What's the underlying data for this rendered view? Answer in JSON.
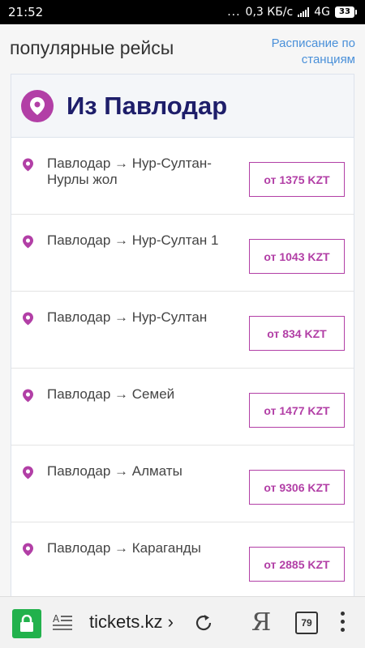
{
  "status_bar": {
    "time": "21:52",
    "dots": "...",
    "speed": "0,3 КБ/с",
    "network": "4G",
    "battery": "33"
  },
  "header": {
    "section_title": "популярные рейсы",
    "schedule_link": "Расписание по станциям"
  },
  "card": {
    "title": "Из Павлодар",
    "routes": [
      {
        "name": "Павлодар → Нур-Султан-Нурлы жол",
        "price": "от 1375 KZT"
      },
      {
        "name": "Павлодар → Нур-Султан 1",
        "price": "от 1043 KZT"
      },
      {
        "name": "Павлодар → Нур-Султан",
        "price": "от 834 KZT"
      },
      {
        "name": "Павлодар → Семей",
        "price": "от 1477 KZT"
      },
      {
        "name": "Павлодар → Алматы",
        "price": "от 9306 KZT"
      },
      {
        "name": "Павлодар → Караганды",
        "price": "от 2885 KZT"
      }
    ]
  },
  "browser_bar": {
    "url": "tickets.kz › ",
    "yandex": "Я",
    "tabs_count": "79",
    "icons": [
      "lock-icon",
      "reader-mode-icon",
      "reload-icon",
      "yandex-icon",
      "tabs-icon",
      "more-icon"
    ]
  },
  "colors": {
    "accent": "#b23fa6",
    "title": "#1e1e6a",
    "link": "#4a90d9",
    "secure": "#22b14c"
  }
}
